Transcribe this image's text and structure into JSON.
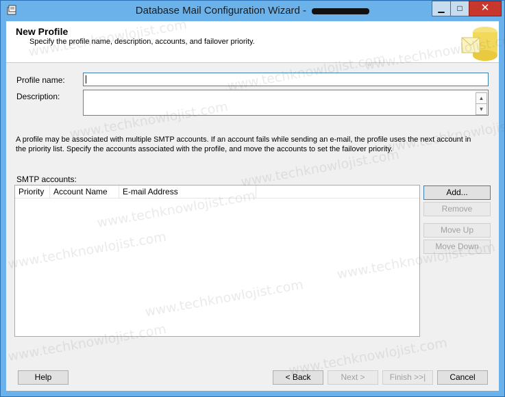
{
  "window": {
    "title": "Database Mail Configuration Wizard -"
  },
  "caption_buttons": {
    "minimize": "▁",
    "maximize": "□",
    "close": "✕"
  },
  "header": {
    "title": "New Profile",
    "description": "Specify the profile name, description, accounts, and failover priority."
  },
  "form": {
    "profile_name_label": "Profile name:",
    "profile_name_value": "",
    "description_label": "Description:",
    "description_value": ""
  },
  "info_text": "A profile may be associated with multiple SMTP accounts. If an account fails while sending an e-mail, the profile uses the next account in the priority list. Specify the accounts associated with the profile, and move the accounts to set the failover priority.",
  "smtp": {
    "label": "SMTP accounts:",
    "columns": [
      "Priority",
      "Account Name",
      "E-mail Address"
    ],
    "rows": []
  },
  "side_buttons": {
    "add": "Add...",
    "remove": "Remove",
    "move_up": "Move Up",
    "move_down": "Move Down"
  },
  "footer": {
    "help": "Help",
    "back": "< Back",
    "next": "Next >",
    "finish": "Finish >>|",
    "cancel": "Cancel"
  },
  "scroll": {
    "up": "▲",
    "down": "▼"
  },
  "watermark": "www.techknowlojist.com",
  "colors": {
    "titlebar": "#6cb2ea",
    "close": "#c7372d",
    "focus": "#3c7fb1"
  },
  "icons": {
    "title": "database-mail-icon",
    "header": "database-mail-wizard-art"
  }
}
